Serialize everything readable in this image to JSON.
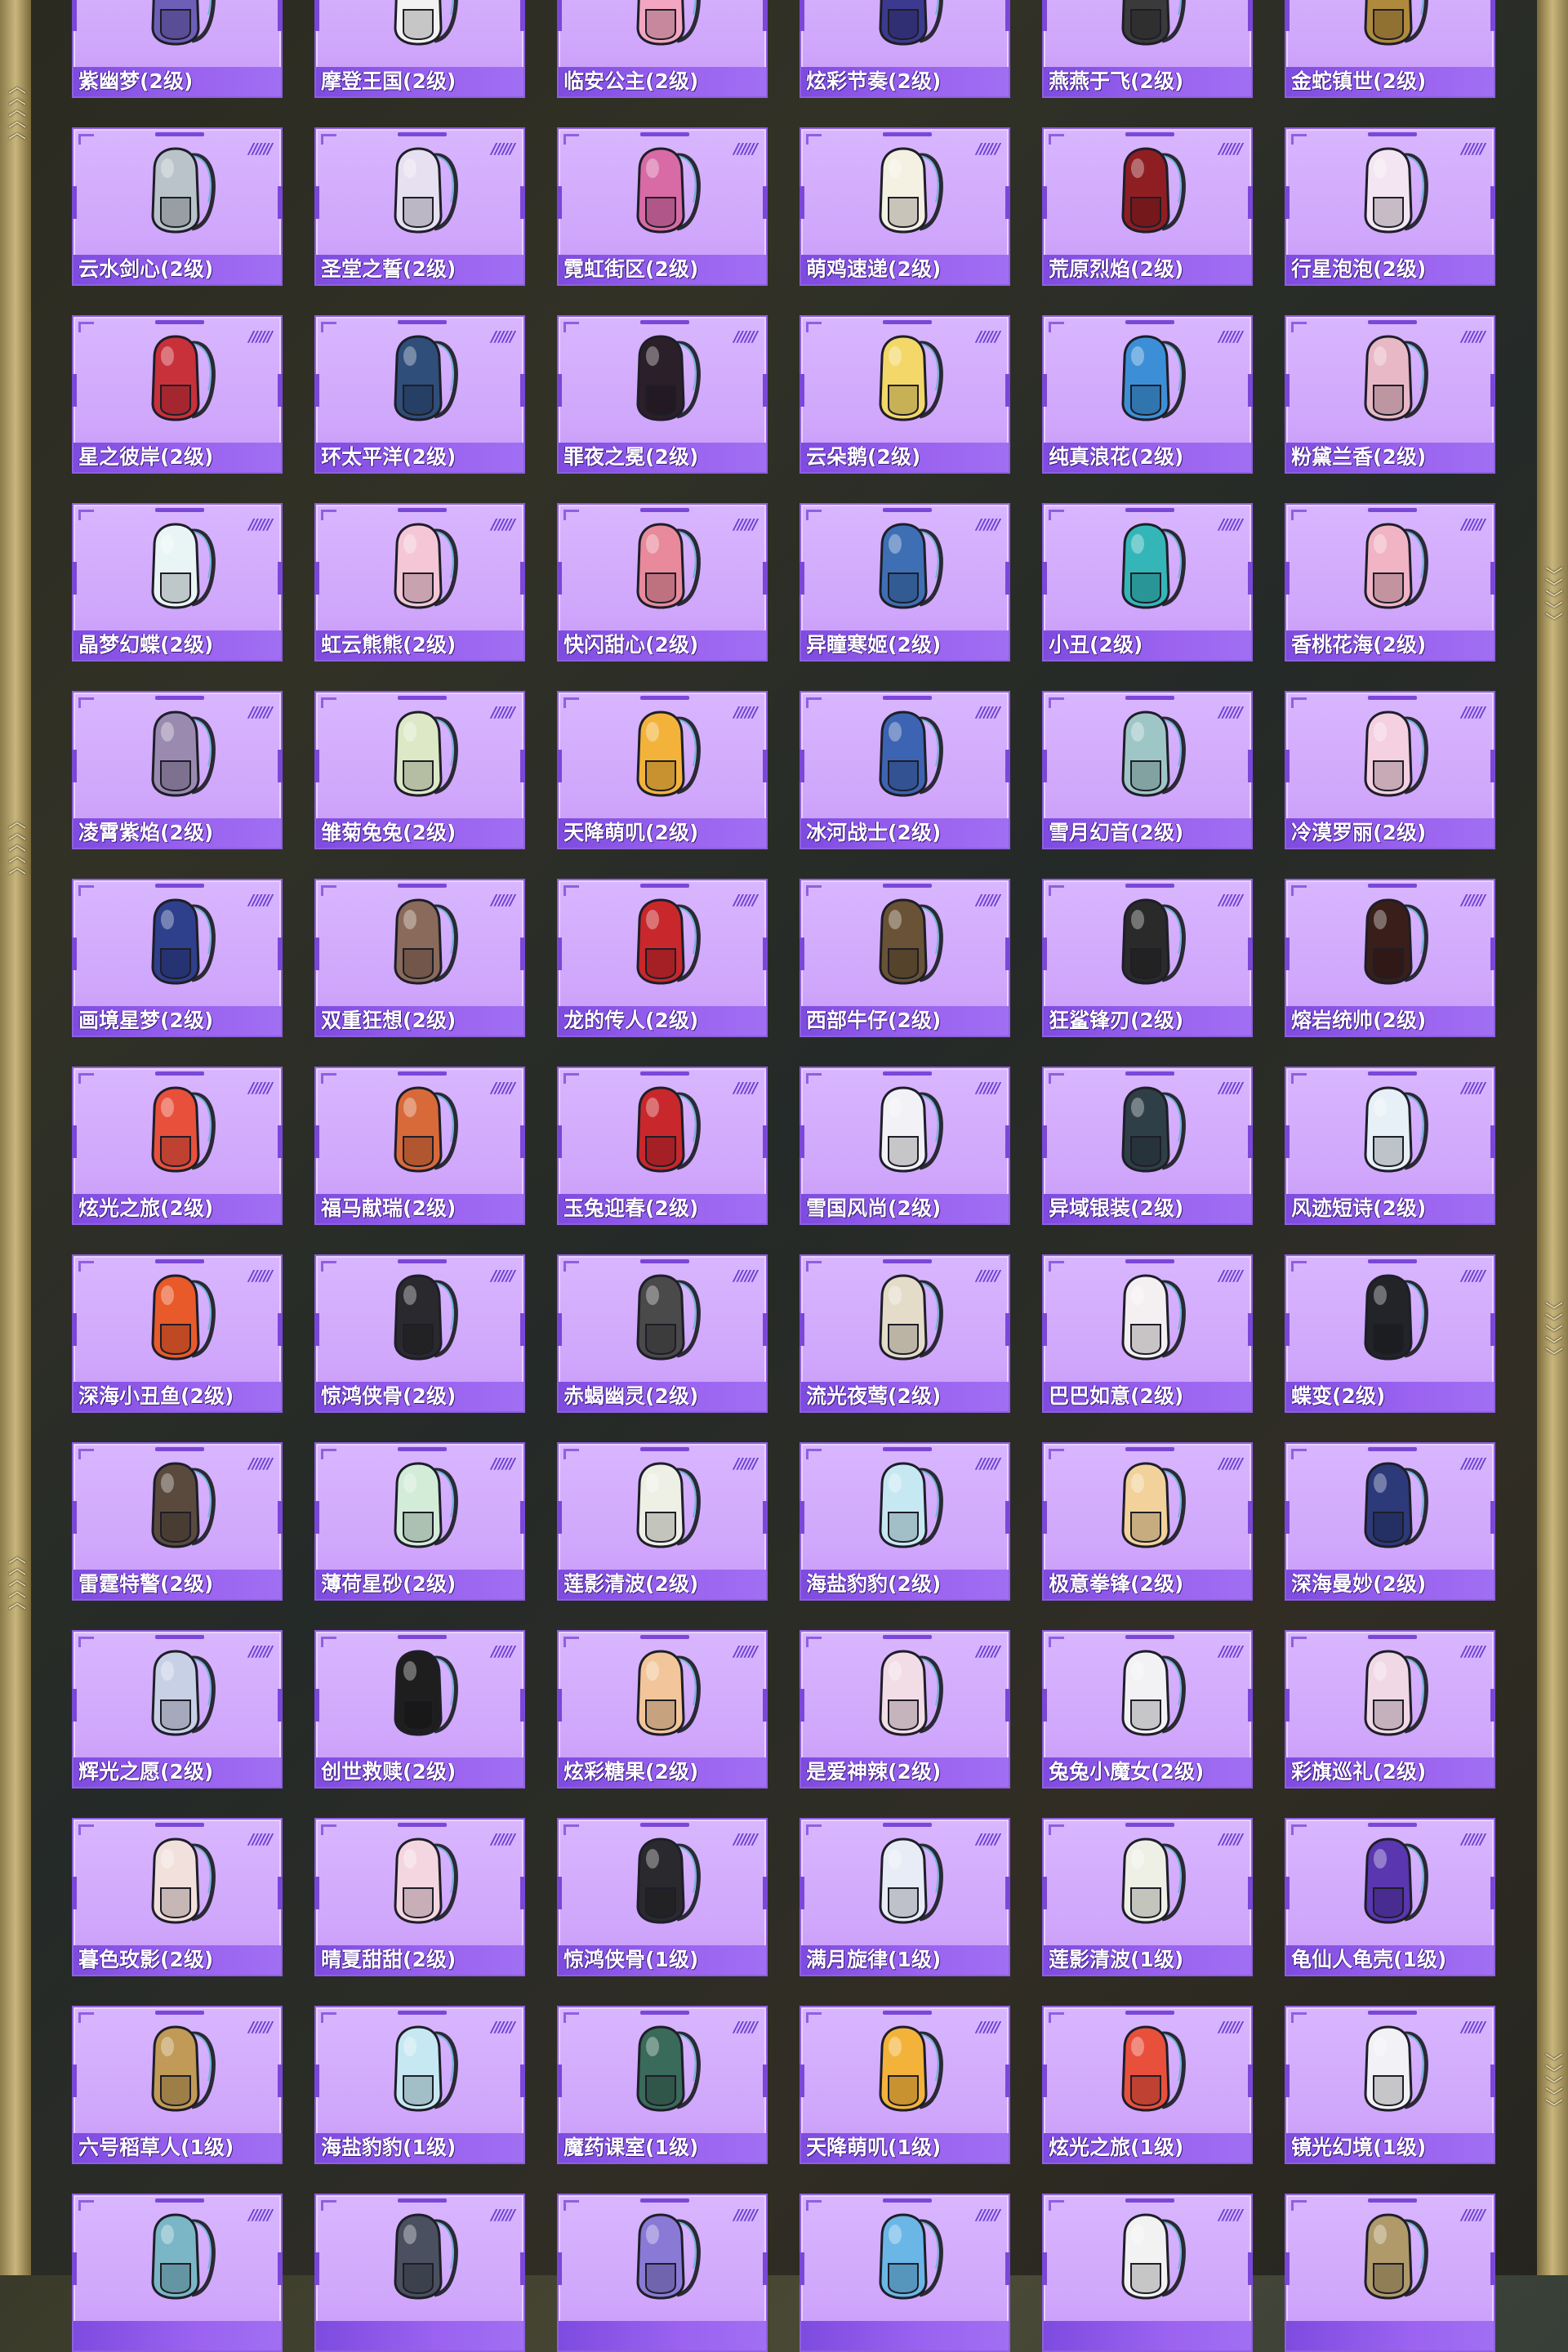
{
  "colors": {
    "card_bg": "#d6b2ff",
    "label_bg": "#8c55e8",
    "accent": "#7b47d8"
  },
  "items": [
    {
      "name": "紫幽梦(2级)",
      "color": "#6d5fb8"
    },
    {
      "name": "摩登王国(2级)",
      "color": "#f2f2f2"
    },
    {
      "name": "临安公主(2级)",
      "color": "#f3a6c0"
    },
    {
      "name": "炫彩节奏(2级)",
      "color": "#3b3a8e"
    },
    {
      "name": "燕燕于飞(2级)",
      "color": "#3a3a3a"
    },
    {
      "name": "金蛇镇世(2级)",
      "color": "#b08a3c"
    },
    {
      "name": "云水剑心(2级)",
      "color": "#b9c3c9"
    },
    {
      "name": "圣堂之誓(2级)",
      "color": "#e6e0f0"
    },
    {
      "name": "霓虹街区(2级)",
      "color": "#d86aa6"
    },
    {
      "name": "萌鸡速递(2级)",
      "color": "#f4f0e2"
    },
    {
      "name": "荒原烈焰(2级)",
      "color": "#8e1e22"
    },
    {
      "name": "行星泡泡(2级)",
      "color": "#f3e6f2"
    },
    {
      "name": "星之彼岸(2级)",
      "color": "#c8303a"
    },
    {
      "name": "环太平洋(2级)",
      "color": "#2f4e7a"
    },
    {
      "name": "罪夜之冕(2级)",
      "color": "#2b1f2a"
    },
    {
      "name": "云朵鹅(2级)",
      "color": "#f3d768"
    },
    {
      "name": "纯真浪花(2级)",
      "color": "#3c8fd6"
    },
    {
      "name": "粉黛兰香(2级)",
      "color": "#e8b8c6"
    },
    {
      "name": "晶梦幻蝶(2级)",
      "color": "#e9f4f4"
    },
    {
      "name": "虹云熊熊(2级)",
      "color": "#f4c6d6"
    },
    {
      "name": "快闪甜心(2级)",
      "color": "#e88a9c"
    },
    {
      "name": "异瞳寒姬(2级)",
      "color": "#3e6fb5"
    },
    {
      "name": "小丑(2级)",
      "color": "#34b6b8"
    },
    {
      "name": "香桃花海(2级)",
      "color": "#f0b4c4"
    },
    {
      "name": "凌霄紫焰(2级)",
      "color": "#9a8ab0"
    },
    {
      "name": "雏菊兔兔(2级)",
      "color": "#dde8c6"
    },
    {
      "name": "天降萌叽(2级)",
      "color": "#f3b33a"
    },
    {
      "name": "冰河战士(2级)",
      "color": "#3d64b3"
    },
    {
      "name": "雪月幻音(2级)",
      "color": "#9fc6c6"
    },
    {
      "name": "冷漠罗丽(2级)",
      "color": "#f4d0e0"
    },
    {
      "name": "画境星梦(2级)",
      "color": "#2e3f8c"
    },
    {
      "name": "双重狂想(2级)",
      "color": "#8a6a5a"
    },
    {
      "name": "龙的传人(2级)",
      "color": "#c8282c"
    },
    {
      "name": "西部牛仔(2级)",
      "color": "#6a5236"
    },
    {
      "name": "狂鲨锋刃(2级)",
      "color": "#2a2a2a"
    },
    {
      "name": "熔岩统帅(2级)",
      "color": "#3a1e1a"
    },
    {
      "name": "炫光之旅(2级)",
      "color": "#e8503c"
    },
    {
      "name": "福马献瑞(2级)",
      "color": "#d86a3a"
    },
    {
      "name": "玉兔迎春(2级)",
      "color": "#c8282c"
    },
    {
      "name": "雪国风尚(2级)",
      "color": "#f2f2f6"
    },
    {
      "name": "异域银装(2级)",
      "color": "#2f3f48"
    },
    {
      "name": "风迹短诗(2级)",
      "color": "#e6f0f6"
    },
    {
      "name": "深海小丑鱼(2级)",
      "color": "#e85a2a"
    },
    {
      "name": "惊鸿侠骨(2级)",
      "color": "#2a2a2e"
    },
    {
      "name": "赤蝎幽灵(2级)",
      "color": "#4a4a4a"
    },
    {
      "name": "流光夜莺(2级)",
      "color": "#e4dcc8"
    },
    {
      "name": "巴巴如意(2级)",
      "color": "#f4f0f2"
    },
    {
      "name": "蝶变(2级)",
      "color": "#222428"
    },
    {
      "name": "雷霆特警(2级)",
      "color": "#5a4a3e"
    },
    {
      "name": "薄荷星砂(2级)",
      "color": "#d2ecd8"
    },
    {
      "name": "莲影清波(2级)",
      "color": "#eef0e6"
    },
    {
      "name": "海盐豹豹(2级)",
      "color": "#c6e8f2"
    },
    {
      "name": "极意拳锋(2级)",
      "color": "#f2d29a"
    },
    {
      "name": "深海曼妙(2级)",
      "color": "#2c3a7a"
    },
    {
      "name": "辉光之愿(2级)",
      "color": "#c8d0e6"
    },
    {
      "name": "创世救赎(2级)",
      "color": "#1e1e1e"
    },
    {
      "name": "炫彩糖果(2级)",
      "color": "#f2c69a"
    },
    {
      "name": "是爱神辣(2级)",
      "color": "#f2dce6"
    },
    {
      "name": "兔兔小魔女(2级)",
      "color": "#f2f2f4"
    },
    {
      "name": "彩旗巡礼(2级)",
      "color": "#f0d8e4"
    },
    {
      "name": "暮色玫影(2级)",
      "color": "#f2e0dc"
    },
    {
      "name": "晴夏甜甜(2级)",
      "color": "#f4d6e0"
    },
    {
      "name": "惊鸿侠骨(1级)",
      "color": "#2a2a2e"
    },
    {
      "name": "满月旋律(1级)",
      "color": "#e8ecf6"
    },
    {
      "name": "莲影清波(1级)",
      "color": "#eef0e6"
    },
    {
      "name": "龟仙人龟壳(1级)",
      "color": "#5a36b0"
    },
    {
      "name": "六号稻草人(1级)",
      "color": "#c09a56"
    },
    {
      "name": "海盐豹豹(1级)",
      "color": "#c6e8f2"
    },
    {
      "name": "魔药课室(1级)",
      "color": "#3a6a5a"
    },
    {
      "name": "天降萌叽(1级)",
      "color": "#f3b33a"
    },
    {
      "name": "炫光之旅(1级)",
      "color": "#e8503c"
    },
    {
      "name": "镜光幻境(1级)",
      "color": "#f2f2f6"
    },
    {
      "name": "",
      "color": "#7ab6c6"
    },
    {
      "name": "",
      "color": "#4a5060"
    },
    {
      "name": "",
      "color": "#8a7ad6"
    },
    {
      "name": "",
      "color": "#6ab6e6"
    },
    {
      "name": "",
      "color": "#f2f2f2"
    },
    {
      "name": "",
      "color": "#b09a6a"
    }
  ]
}
